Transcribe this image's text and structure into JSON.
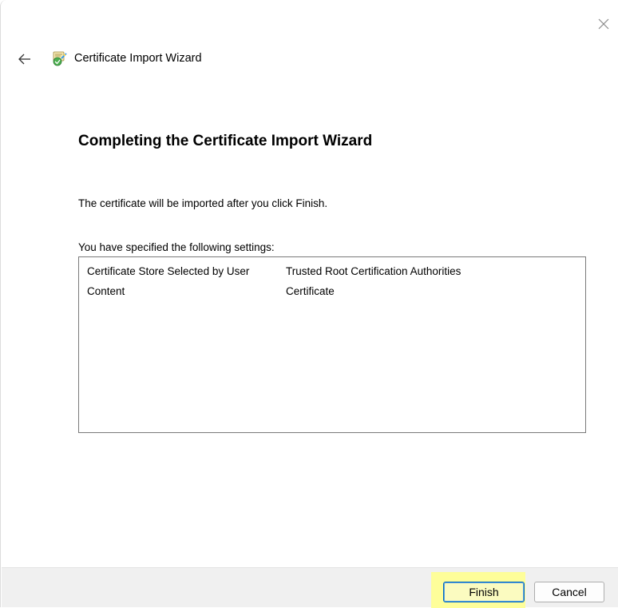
{
  "window": {
    "title": "Certificate Import Wizard",
    "icons": {
      "close": "close-icon",
      "back": "back-arrow-icon",
      "wizard": "certificate-wizard-icon"
    }
  },
  "page": {
    "heading": "Completing the Certificate Import Wizard",
    "description": "The certificate will be imported after you click Finish.",
    "settings_label": "You have specified the following settings:",
    "settings": [
      {
        "key": "Certificate Store Selected by User",
        "value": "Trusted Root Certification Authorities"
      },
      {
        "key": "Content",
        "value": "Certificate"
      }
    ]
  },
  "footer": {
    "finish_label": "Finish",
    "cancel_label": "Cancel",
    "highlight_color": "#fefe9a"
  }
}
